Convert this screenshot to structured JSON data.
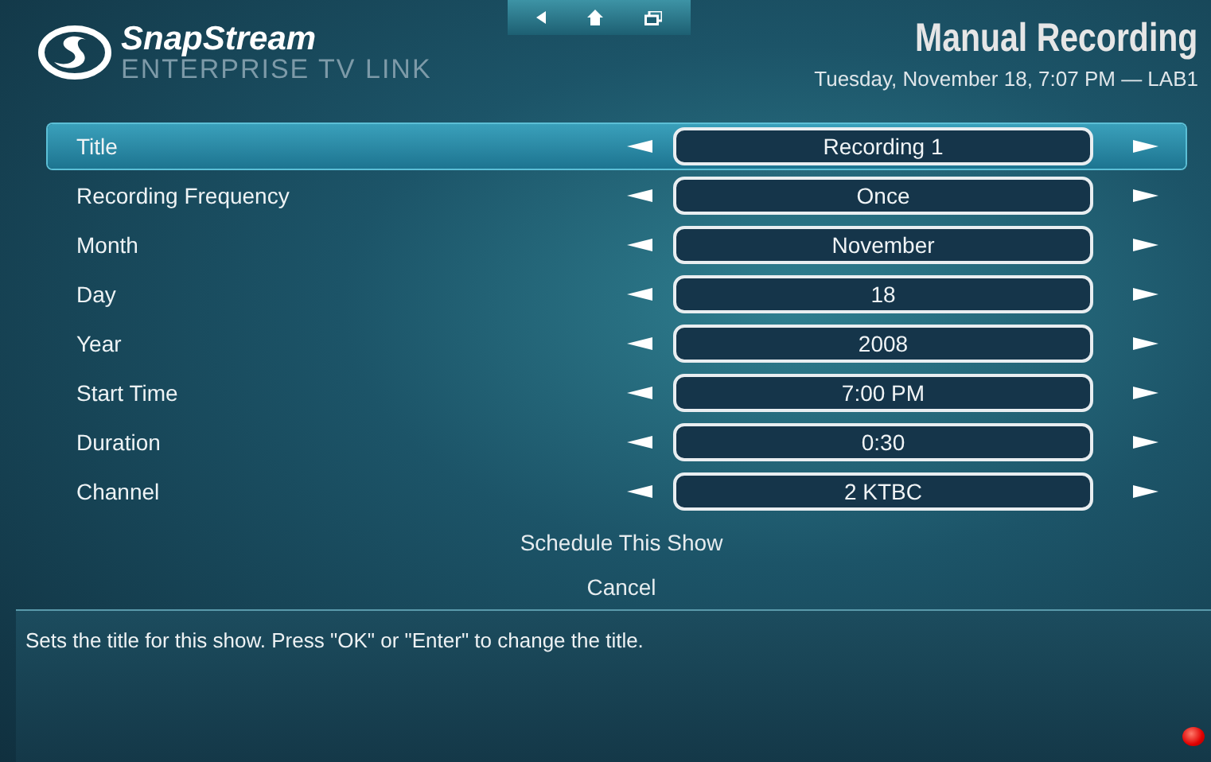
{
  "header": {
    "brand": "SnapStream",
    "subtitle": "ENTERPRISE TV LINK",
    "title": "Manual Recording",
    "datetime": "Tuesday, November 18, 7:07 PM — LAB1"
  },
  "settings": [
    {
      "label": "Title",
      "value": "Recording 1",
      "selected": true
    },
    {
      "label": "Recording Frequency",
      "value": "Once",
      "selected": false
    },
    {
      "label": "Month",
      "value": "November",
      "selected": false
    },
    {
      "label": "Day",
      "value": "18",
      "selected": false
    },
    {
      "label": "Year",
      "value": "2008",
      "selected": false
    },
    {
      "label": "Start Time",
      "value": "7:00 PM",
      "selected": false
    },
    {
      "label": "Duration",
      "value": "0:30",
      "selected": false
    },
    {
      "label": "Channel",
      "value": "2 KTBC",
      "selected": false
    }
  ],
  "actions": [
    "Schedule This Show",
    "Cancel"
  ],
  "description": "Sets the title for this show. Press \"OK\" or \"Enter\" to change the title.",
  "recording_indicator": {
    "on": true
  }
}
